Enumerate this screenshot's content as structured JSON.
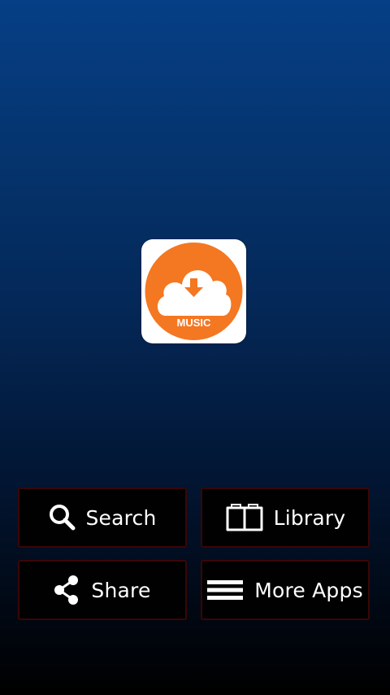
{
  "app": {
    "logo_text": "MUSIC",
    "logo_icon": "cloud-download-icon",
    "brand_color": "#f47722"
  },
  "menu": {
    "search": {
      "label": "Search",
      "icon": "search-icon"
    },
    "library": {
      "label": "Library",
      "icon": "book-icon"
    },
    "share": {
      "label": "Share",
      "icon": "share-icon"
    },
    "more_apps": {
      "label": "More Apps",
      "icon": "menu-icon"
    }
  },
  "colors": {
    "background_top": "#063f86",
    "background_bottom": "#000000",
    "button_background": "#010101",
    "button_border": "#3a0606"
  }
}
